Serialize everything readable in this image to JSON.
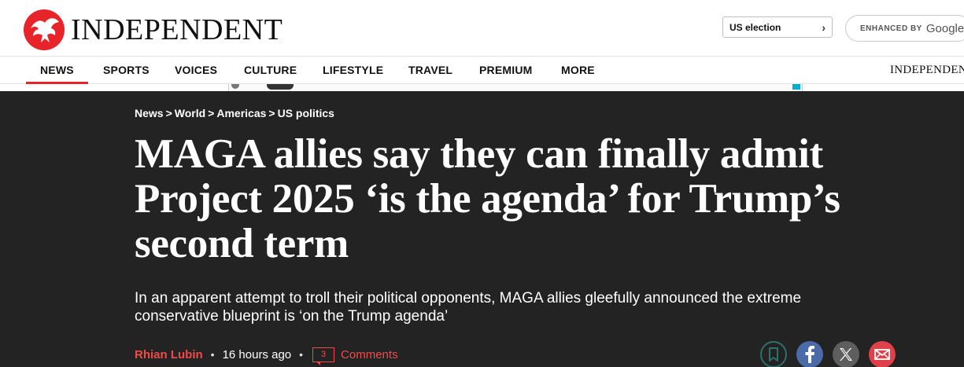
{
  "header": {
    "logo_text": "INDEPENDENT",
    "us_election_label": "US election",
    "search_enhanced_label": "ENHANCED BY",
    "search_provider": "Google"
  },
  "nav": {
    "items": [
      {
        "label": "NEWS",
        "active": true
      },
      {
        "label": "SPORTS"
      },
      {
        "label": "VOICES"
      },
      {
        "label": "CULTURE"
      },
      {
        "label": "LIFESTYLE"
      },
      {
        "label": "TRAVEL"
      },
      {
        "label": "PREMIUM"
      },
      {
        "label": "MORE"
      }
    ],
    "brand_text": "INDEPENDENT"
  },
  "breadcrumb": [
    "News",
    "World",
    "Americas",
    "US politics"
  ],
  "breadcrumb_separator": ">",
  "article": {
    "headline": "MAGA allies say they can finally admit Project 2025 ‘is the agenda’ for Trump’s second term",
    "standfirst": "In an apparent attempt to troll their political opponents, MAGA allies gleefully announced the extreme conservative blueprint is ‘on the Trump agenda’",
    "author": "Rhian Lubin",
    "time": "16 hours ago",
    "comment_count": "3",
    "comments_label": "Comments"
  },
  "share_icons": [
    "bookmark-icon",
    "facebook-icon",
    "x-icon",
    "mail-icon"
  ],
  "colors": {
    "brand_red": "#e8242b",
    "hero_bg": "#232323",
    "author_red": "#f04b4b",
    "facebook_blue": "#4a6aa8",
    "mail_red": "#e0404a"
  }
}
